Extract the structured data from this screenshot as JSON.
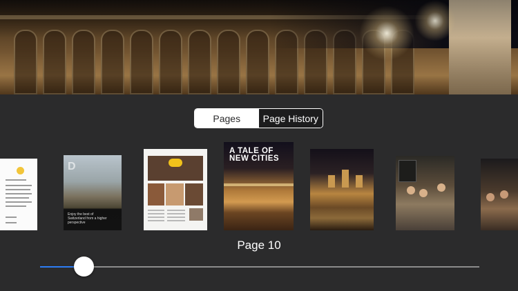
{
  "segment": {
    "pages_label": "Pages",
    "history_label": "Page History",
    "active": "Pages"
  },
  "magazine_cover_title": "A TALE OF NEW CITIES",
  "thumb2_caption": "Enjoy the best of Switzerland from a higher perspective",
  "current_page_label": "Page 10",
  "slider": {
    "position_fraction": 0.1,
    "accent_color": "#2d7df6"
  },
  "colors": {
    "background": "#2b2b2c",
    "thumb_knob": "#ffffff"
  },
  "icons": [
    "avatar-icon"
  ]
}
